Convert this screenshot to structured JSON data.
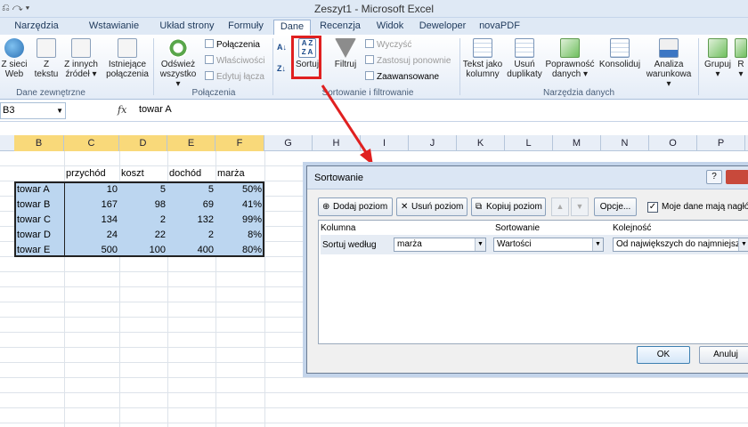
{
  "window": {
    "title": "Zeszyt1 - Microsoft Excel",
    "quick_access": "⎌ ↷ ▾"
  },
  "tabs": [
    "Narzędzia główne",
    "Wstawianie",
    "Układ strony",
    "Formuły",
    "Dane",
    "Recenzja",
    "Widok",
    "Deweloper",
    "novaPDF"
  ],
  "active_tab": "Dane",
  "ribbon": {
    "external_data": {
      "web": "Z sieci\nWeb",
      "text": "Z\ntekstu",
      "other": "Z innych\nźródeł ▾",
      "label": "Dane zewnętrzne"
    },
    "existing": "Istniejące\npołączenia",
    "connections": {
      "refresh": "Odśwież\nwszystko ▾",
      "connections": "Połączenia",
      "properties": "Właściwości",
      "edit_links": "Edytuj łącza",
      "label": "Połączenia"
    },
    "sort_filter": {
      "sort": "Sortuj",
      "filter": "Filtruj",
      "clear": "Wyczyść",
      "reapply": "Zastosuj ponownie",
      "advanced": "Zaawansowane",
      "label": "Sortowanie i filtrowanie",
      "sort_icon_text": "A Z\nZ A"
    },
    "data_tools": {
      "text_to_columns": "Tekst jako\nkolumny",
      "remove_dupes": "Usuń\nduplikaty",
      "validation": "Poprawność\ndanych ▾",
      "consolidate": "Konsoliduj",
      "what_if": "Analiza\nwarunkowa ▾",
      "label": "Narzędzia danych"
    },
    "outline": {
      "group": "Grupuj\n▾",
      "ungroup": "R\n▾"
    }
  },
  "formula_bar": {
    "name_box": "B3",
    "fx": "fx",
    "value": "towar A"
  },
  "columns": [
    "B",
    "C",
    "D",
    "E",
    "F",
    "G",
    "H",
    "I",
    "J",
    "K",
    "L",
    "M",
    "N",
    "O",
    "P"
  ],
  "sheet": {
    "headers": [
      "przychód",
      "koszt",
      "dochód",
      "marża"
    ],
    "rows": [
      {
        "name": "towar A",
        "przychod": "10",
        "koszt": "5",
        "dochod": "5",
        "marza": "50%"
      },
      {
        "name": "towar B",
        "przychod": "167",
        "koszt": "98",
        "dochod": "69",
        "marza": "41%"
      },
      {
        "name": "towar C",
        "przychod": "134",
        "koszt": "2",
        "dochod": "132",
        "marza": "99%"
      },
      {
        "name": "towar D",
        "przychod": "24",
        "koszt": "22",
        "dochod": "2",
        "marza": "8%"
      },
      {
        "name": "towar E",
        "przychod": "500",
        "koszt": "100",
        "dochod": "400",
        "marza": "80%"
      }
    ]
  },
  "dialog": {
    "title": "Sortowanie",
    "help": "?",
    "add_level": "Dodaj poziom",
    "delete_level": "Usuń poziom",
    "copy_level": "Kopiuj poziom",
    "options": "Opcje...",
    "has_headers": "Moje dane mają nagłówki",
    "col_header": "Kolumna",
    "sort_on_header": "Sortowanie",
    "order_header": "Kolejność",
    "row_label": "Sortuj według",
    "column_value": "marża",
    "sort_on_value": "Wartości",
    "order_value": "Od największych do najmniejszych",
    "ok": "OK",
    "cancel": "Anuluj"
  },
  "colors": {
    "accent": "#e02020",
    "selection": "#bcd6f0",
    "ribbon": "#dfe9f5"
  }
}
